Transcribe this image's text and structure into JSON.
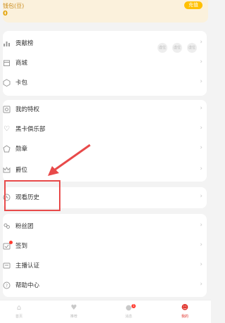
{
  "wallet": {
    "title": "钱包(豆)",
    "value": "0",
    "recharge_label": "充值"
  },
  "sections": {
    "s1": [
      {
        "label": "贡献榜",
        "icon": "bar-chart-icon"
      },
      {
        "label": "商城",
        "icon": "store-icon"
      },
      {
        "label": "卡包",
        "icon": "card-icon"
      }
    ],
    "s2": [
      {
        "label": "我的特权",
        "icon": "privilege-icon"
      },
      {
        "label": "黑卡俱乐部",
        "icon": "heart-icon"
      },
      {
        "label": "勋章",
        "icon": "medal-icon"
      },
      {
        "label": "爵位",
        "icon": "crown-icon"
      }
    ],
    "s3": [
      {
        "label": "观看历史",
        "icon": "history-icon"
      }
    ],
    "s4": [
      {
        "label": "粉丝团",
        "icon": "fans-icon"
      },
      {
        "label": "签到",
        "icon": "checkin-icon"
      },
      {
        "label": "主播认证",
        "icon": "id-card-icon"
      },
      {
        "label": "帮助中心",
        "icon": "help-icon"
      }
    ]
  },
  "contribution_badges": [
    "虚位",
    "虚位",
    "虚位"
  ],
  "tabbar": {
    "items": [
      {
        "label": "首页",
        "icon": "home-icon"
      },
      {
        "label": "推荐",
        "icon": "recommend-icon"
      },
      {
        "label": "消息",
        "icon": "message-icon",
        "badge": "1"
      },
      {
        "label": "我的",
        "icon": "profile-icon"
      }
    ]
  },
  "colors": {
    "accent": "#e0332b",
    "gold": "#ffc000",
    "annotation": "#e84a4a"
  }
}
